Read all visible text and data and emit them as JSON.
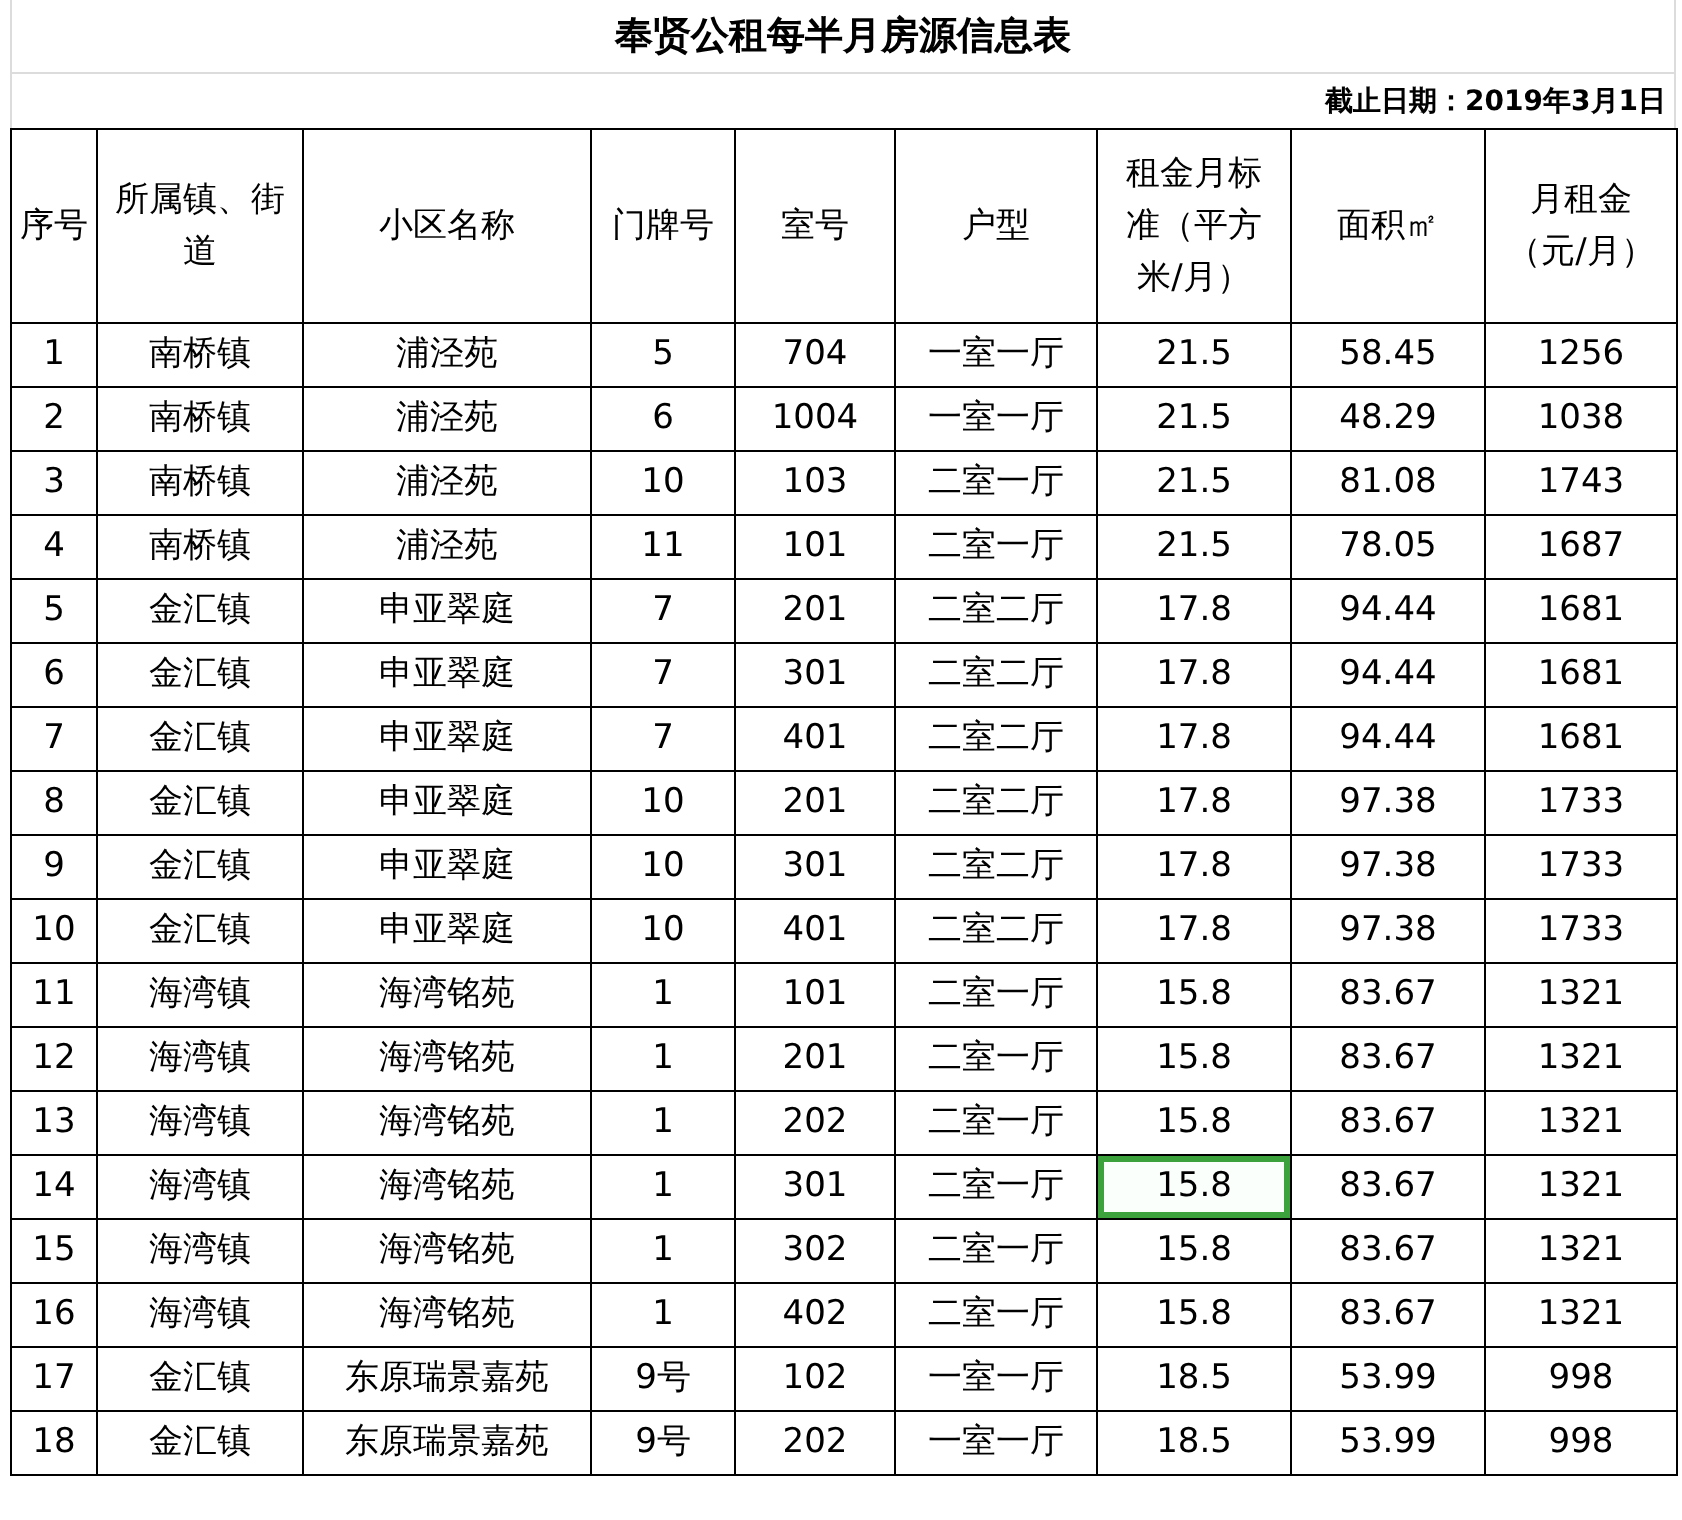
{
  "title": "奉贤公租每半月房源信息表",
  "cutoff_date": "截止日期：2019年3月1日",
  "columns": [
    "序号",
    "所属镇、街道",
    "小区名称",
    "门牌号",
    "室号",
    "户型",
    "租金月标准（平方米/月）",
    "面积㎡",
    "月租金（元/月）"
  ],
  "rows": [
    [
      {
        "text": "1",
        "selected": false
      },
      {
        "text": "南桥镇",
        "selected": false
      },
      {
        "text": "浦泾苑",
        "selected": false
      },
      {
        "text": "5",
        "selected": false
      },
      {
        "text": "704",
        "selected": false
      },
      {
        "text": "一室一厅",
        "selected": false
      },
      {
        "text": "21.5",
        "selected": false
      },
      {
        "text": "58.45",
        "selected": false
      },
      {
        "text": "1256",
        "selected": false
      }
    ],
    [
      {
        "text": "2",
        "selected": false
      },
      {
        "text": "南桥镇",
        "selected": false
      },
      {
        "text": "浦泾苑",
        "selected": false
      },
      {
        "text": "6",
        "selected": false
      },
      {
        "text": "1004",
        "selected": false
      },
      {
        "text": "一室一厅",
        "selected": false
      },
      {
        "text": "21.5",
        "selected": false
      },
      {
        "text": "48.29",
        "selected": false
      },
      {
        "text": "1038",
        "selected": false
      }
    ],
    [
      {
        "text": "3",
        "selected": false
      },
      {
        "text": "南桥镇",
        "selected": false
      },
      {
        "text": "浦泾苑",
        "selected": false
      },
      {
        "text": "10",
        "selected": false
      },
      {
        "text": "103",
        "selected": false
      },
      {
        "text": "二室一厅",
        "selected": false
      },
      {
        "text": "21.5",
        "selected": false
      },
      {
        "text": "81.08",
        "selected": false
      },
      {
        "text": "1743",
        "selected": false
      }
    ],
    [
      {
        "text": "4",
        "selected": false
      },
      {
        "text": "南桥镇",
        "selected": false
      },
      {
        "text": "浦泾苑",
        "selected": false
      },
      {
        "text": "11",
        "selected": false
      },
      {
        "text": "101",
        "selected": false
      },
      {
        "text": "二室一厅",
        "selected": false
      },
      {
        "text": "21.5",
        "selected": false
      },
      {
        "text": "78.05",
        "selected": false
      },
      {
        "text": "1687",
        "selected": false
      }
    ],
    [
      {
        "text": "5",
        "selected": false
      },
      {
        "text": "金汇镇",
        "selected": false
      },
      {
        "text": "申亚翠庭",
        "selected": false
      },
      {
        "text": "7",
        "selected": false
      },
      {
        "text": "201",
        "selected": false
      },
      {
        "text": "二室二厅",
        "selected": false
      },
      {
        "text": "17.8",
        "selected": false
      },
      {
        "text": "94.44",
        "selected": false
      },
      {
        "text": "1681",
        "selected": false
      }
    ],
    [
      {
        "text": "6",
        "selected": false
      },
      {
        "text": "金汇镇",
        "selected": false
      },
      {
        "text": "申亚翠庭",
        "selected": false
      },
      {
        "text": "7",
        "selected": false
      },
      {
        "text": "301",
        "selected": false
      },
      {
        "text": "二室二厅",
        "selected": false
      },
      {
        "text": "17.8",
        "selected": false
      },
      {
        "text": "94.44",
        "selected": false
      },
      {
        "text": "1681",
        "selected": false
      }
    ],
    [
      {
        "text": "7",
        "selected": false
      },
      {
        "text": "金汇镇",
        "selected": false
      },
      {
        "text": "申亚翠庭",
        "selected": false
      },
      {
        "text": "7",
        "selected": false
      },
      {
        "text": "401",
        "selected": false
      },
      {
        "text": "二室二厅",
        "selected": false
      },
      {
        "text": "17.8",
        "selected": false
      },
      {
        "text": "94.44",
        "selected": false
      },
      {
        "text": "1681",
        "selected": false
      }
    ],
    [
      {
        "text": "8",
        "selected": false
      },
      {
        "text": "金汇镇",
        "selected": false
      },
      {
        "text": "申亚翠庭",
        "selected": false
      },
      {
        "text": "10",
        "selected": false
      },
      {
        "text": "201",
        "selected": false
      },
      {
        "text": "二室二厅",
        "selected": false
      },
      {
        "text": "17.8",
        "selected": false
      },
      {
        "text": "97.38",
        "selected": false
      },
      {
        "text": "1733",
        "selected": false
      }
    ],
    [
      {
        "text": "9",
        "selected": false
      },
      {
        "text": "金汇镇",
        "selected": false
      },
      {
        "text": "申亚翠庭",
        "selected": false
      },
      {
        "text": "10",
        "selected": false
      },
      {
        "text": "301",
        "selected": false
      },
      {
        "text": "二室二厅",
        "selected": false
      },
      {
        "text": "17.8",
        "selected": false
      },
      {
        "text": "97.38",
        "selected": false
      },
      {
        "text": "1733",
        "selected": false
      }
    ],
    [
      {
        "text": "10",
        "selected": false
      },
      {
        "text": "金汇镇",
        "selected": false
      },
      {
        "text": "申亚翠庭",
        "selected": false
      },
      {
        "text": "10",
        "selected": false
      },
      {
        "text": "401",
        "selected": false
      },
      {
        "text": "二室二厅",
        "selected": false
      },
      {
        "text": "17.8",
        "selected": false
      },
      {
        "text": "97.38",
        "selected": false
      },
      {
        "text": "1733",
        "selected": false
      }
    ],
    [
      {
        "text": "11",
        "selected": false
      },
      {
        "text": "海湾镇",
        "selected": false
      },
      {
        "text": "海湾铭苑",
        "selected": false
      },
      {
        "text": "1",
        "selected": false
      },
      {
        "text": "101",
        "selected": false
      },
      {
        "text": "二室一厅",
        "selected": false
      },
      {
        "text": "15.8",
        "selected": false
      },
      {
        "text": "83.67",
        "selected": false
      },
      {
        "text": "1321",
        "selected": false
      }
    ],
    [
      {
        "text": "12",
        "selected": false
      },
      {
        "text": "海湾镇",
        "selected": false
      },
      {
        "text": "海湾铭苑",
        "selected": false
      },
      {
        "text": "1",
        "selected": false
      },
      {
        "text": "201",
        "selected": false
      },
      {
        "text": "二室一厅",
        "selected": false
      },
      {
        "text": "15.8",
        "selected": false
      },
      {
        "text": "83.67",
        "selected": false
      },
      {
        "text": "1321",
        "selected": false
      }
    ],
    [
      {
        "text": "13",
        "selected": false
      },
      {
        "text": "海湾镇",
        "selected": false
      },
      {
        "text": "海湾铭苑",
        "selected": false
      },
      {
        "text": "1",
        "selected": false
      },
      {
        "text": "202",
        "selected": false
      },
      {
        "text": "二室一厅",
        "selected": false
      },
      {
        "text": "15.8",
        "selected": false
      },
      {
        "text": "83.67",
        "selected": false
      },
      {
        "text": "1321",
        "selected": false
      }
    ],
    [
      {
        "text": "14",
        "selected": false
      },
      {
        "text": "海湾镇",
        "selected": false
      },
      {
        "text": "海湾铭苑",
        "selected": false
      },
      {
        "text": "1",
        "selected": false
      },
      {
        "text": "301",
        "selected": false
      },
      {
        "text": "二室一厅",
        "selected": false
      },
      {
        "text": "15.8",
        "selected": true
      },
      {
        "text": "83.67",
        "selected": false
      },
      {
        "text": "1321",
        "selected": false
      }
    ],
    [
      {
        "text": "15",
        "selected": false
      },
      {
        "text": "海湾镇",
        "selected": false
      },
      {
        "text": "海湾铭苑",
        "selected": false
      },
      {
        "text": "1",
        "selected": false
      },
      {
        "text": "302",
        "selected": false
      },
      {
        "text": "二室一厅",
        "selected": false
      },
      {
        "text": "15.8",
        "selected": false
      },
      {
        "text": "83.67",
        "selected": false
      },
      {
        "text": "1321",
        "selected": false
      }
    ],
    [
      {
        "text": "16",
        "selected": false
      },
      {
        "text": "海湾镇",
        "selected": false
      },
      {
        "text": "海湾铭苑",
        "selected": false
      },
      {
        "text": "1",
        "selected": false
      },
      {
        "text": "402",
        "selected": false
      },
      {
        "text": "二室一厅",
        "selected": false
      },
      {
        "text": "15.8",
        "selected": false
      },
      {
        "text": "83.67",
        "selected": false
      },
      {
        "text": "1321",
        "selected": false
      }
    ],
    [
      {
        "text": "17",
        "selected": false
      },
      {
        "text": "金汇镇",
        "selected": false
      },
      {
        "text": "东原瑞景嘉苑",
        "selected": false
      },
      {
        "text": "9号",
        "selected": false
      },
      {
        "text": "102",
        "selected": false
      },
      {
        "text": "一室一厅",
        "selected": false
      },
      {
        "text": "18.5",
        "selected": false
      },
      {
        "text": "53.99",
        "selected": false
      },
      {
        "text": "998",
        "selected": false
      }
    ],
    [
      {
        "text": "18",
        "selected": false
      },
      {
        "text": "金汇镇",
        "selected": false
      },
      {
        "text": "东原瑞景嘉苑",
        "selected": false
      },
      {
        "text": "9号",
        "selected": false
      },
      {
        "text": "202",
        "selected": false
      },
      {
        "text": "一室一厅",
        "selected": false
      },
      {
        "text": "18.5",
        "selected": false
      },
      {
        "text": "53.99",
        "selected": false
      },
      {
        "text": "998",
        "selected": false
      }
    ]
  ]
}
